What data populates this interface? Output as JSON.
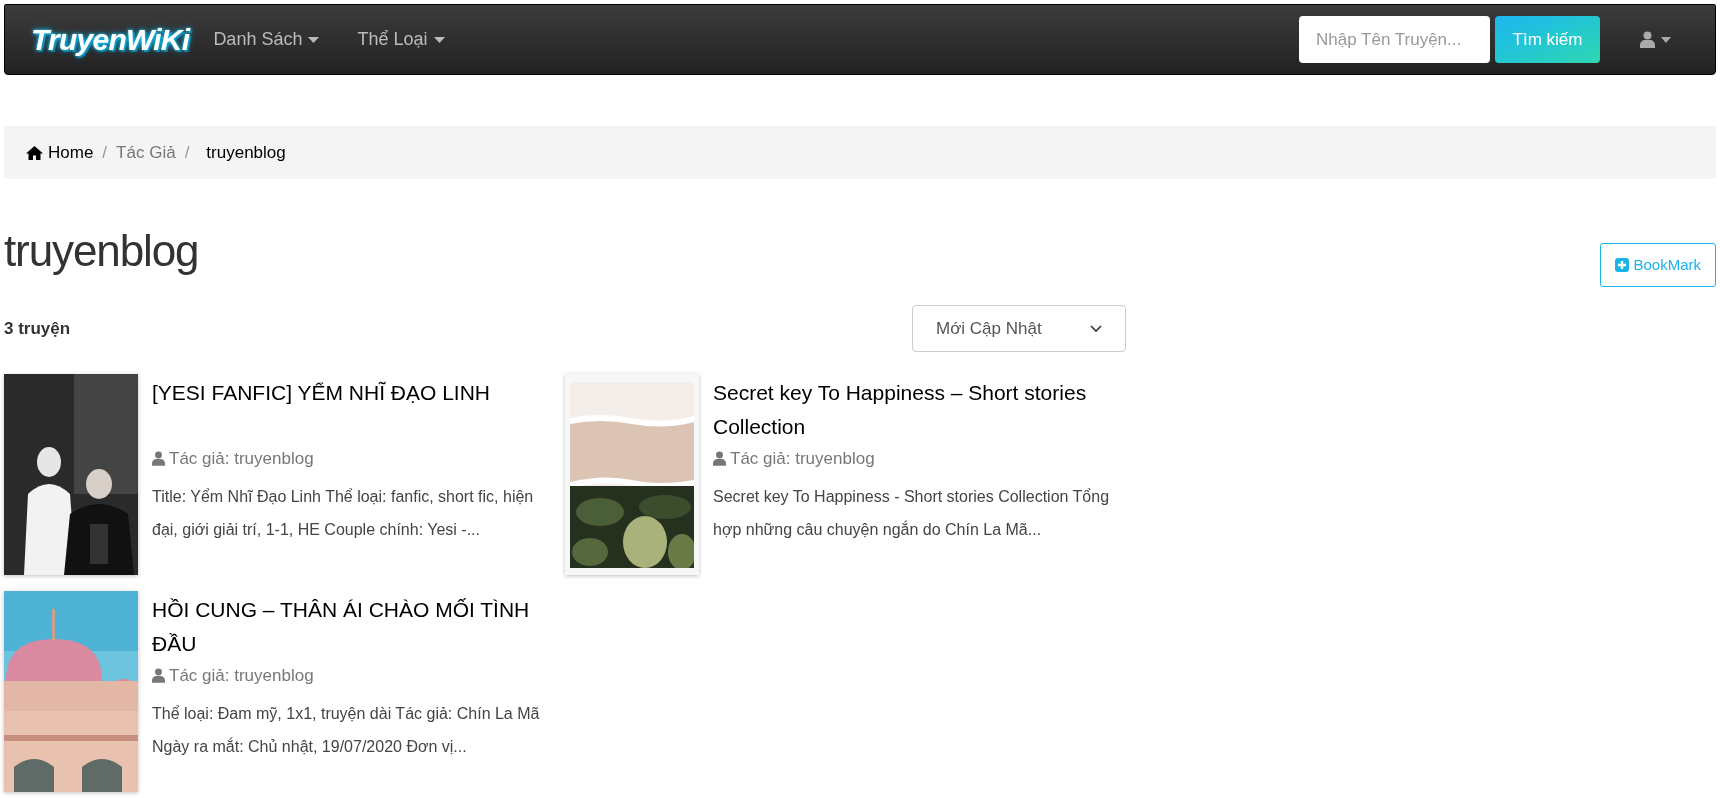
{
  "navbar": {
    "logo": "TruyenWiKi",
    "menus": [
      {
        "label": "Danh Sách"
      },
      {
        "label": "Thể Loại"
      }
    ],
    "search": {
      "placeholder": "Nhập Tên Truyện...",
      "button": "Tìm kiếm"
    }
  },
  "breadcrumb_separator": "/",
  "breadcrumb": [
    {
      "label": "Home",
      "kind": "home"
    },
    {
      "label": "Tác Giả",
      "kind": "link"
    },
    {
      "label": "truyenblog",
      "kind": "current"
    }
  ],
  "heading": "truyenblog",
  "bookmark_button": "BookMark",
  "count": "3 truyện",
  "sort_select": {
    "value": "Mới Cập Nhật"
  },
  "stories": [
    {
      "title": "[YESI FANFIC] YỂM NHĨ ĐẠO LINH",
      "author": "Tác giả: truyenblog",
      "description": "Title: Yểm Nhĩ Đạo Linh Thể loại: fanfic, short fic, hiện đại, giới giải trí, 1-1, HE Couple chính: Yesi -..."
    },
    {
      "title": "Secret key To Happiness – Short stories Collection",
      "author": "Tác giả: truyenblog",
      "description": "Secret key To Happiness - Short stories Collection Tổng hợp những câu chuyện ngắn do Chín La Mã..."
    },
    {
      "title": "HỒI CUNG – THÂN ÁI CHÀO MỐI TÌNH ĐẦU",
      "author": "Tác giả: truyenblog",
      "description": "Thể loại: Đam mỹ, 1x1, truyện dài Tác giả: Chín La Mã Ngày ra mắt: Chủ nhật, 19/07/2020 Đơn vị..."
    }
  ]
}
